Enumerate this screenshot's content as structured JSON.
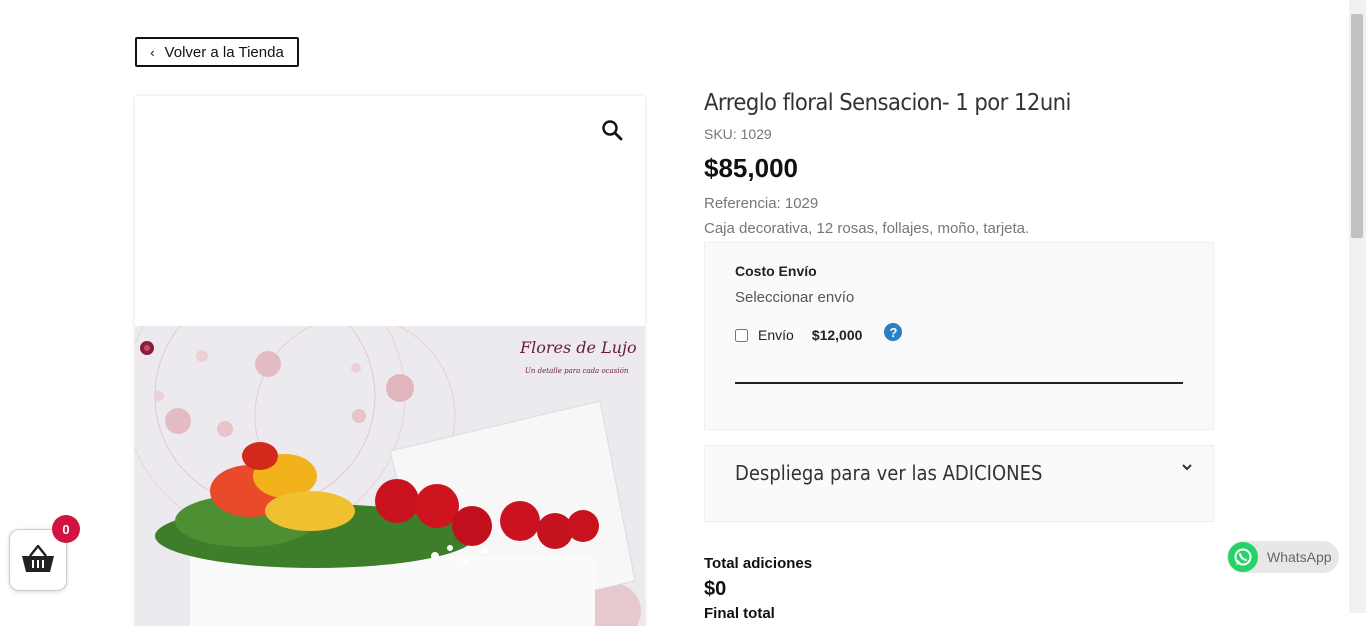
{
  "nav": {
    "back_label": "Volver a la Tienda"
  },
  "gallery": {
    "zoom_icon": "search-icon",
    "brand_name": "Flores de Lujo",
    "brand_tagline": "Un detalle para cada ocasión"
  },
  "product": {
    "title": "Arreglo floral Sensacion- 1 por 12uni",
    "sku": "SKU: 1029",
    "price": "$85,000",
    "reference": "Referencia: 1029",
    "description": "Caja decorativa, 12 rosas, follajes, moño, tarjeta."
  },
  "shipping": {
    "title": "Costo Envío",
    "subtitle": "Seleccionar envío",
    "option_label": "Envío",
    "option_price": "$12,000",
    "option_checked": false,
    "help_icon": "question-circle-icon"
  },
  "additions": {
    "label": "Despliega para ver las ADICIONES",
    "chevron_icon": "chevron-down-icon"
  },
  "totals": {
    "additions_label": "Total adiciones",
    "additions_value": "$0",
    "final_label": "Final total"
  },
  "cart": {
    "icon": "basket-icon",
    "count": "0"
  },
  "whatsapp": {
    "label": "WhatsApp",
    "icon": "whatsapp-icon"
  },
  "colors": {
    "badge": "#d1143f",
    "help": "#2a7fc5",
    "whatsapp": "#25d366"
  }
}
